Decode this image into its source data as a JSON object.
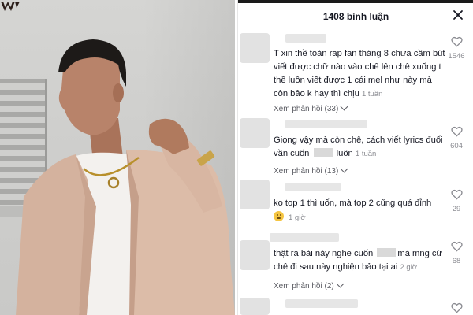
{
  "photo": {
    "logo_name": "w-logo",
    "colors": {
      "jacket": "#d9b8a4",
      "shirt": "#f3f1ee",
      "skin": "#b07a5e",
      "hair": "#1d1a18",
      "wall": "#d3d3d1"
    }
  },
  "comments_panel": {
    "title": "1408 bình luận",
    "close_icon": "close-icon",
    "comments": [
      {
        "text_parts": [
          "T xin thề toàn rap fan tháng 8 chưa cầm bút viết được chữ nào vào chê lên chê xuống t thề luôn viết được 1 cái mel như này mà còn bảo k hay thì chịu "
        ],
        "time": "1 tuần",
        "replies": "Xem phản hồi (33)",
        "likes": "1546"
      },
      {
        "text_parts": [
          "Giọng vậy mà còn chê, cách viết lyrics đuối vần cuốn ",
          " luôn "
        ],
        "time": "1 tuần",
        "replies": "Xem phản hồi (13)",
        "likes": "604"
      },
      {
        "text_parts": [
          "ko top 1 thì uốn, mà top 2 cũng quá đỉnh"
        ],
        "time": "1 giờ",
        "emoji": "worried-face",
        "likes": "29"
      },
      {
        "text_parts": [
          "thật ra bài này nghe cuốn ",
          "mà mng cứ chê đi sau này nghiện bảo tại ai "
        ],
        "time": "2 giờ",
        "replies": "Xem phản hồi (2)",
        "likes": "68"
      }
    ],
    "colors": {
      "text": "#161823",
      "muted": "#8a8b91",
      "like_icon": "#8a8b91"
    }
  }
}
